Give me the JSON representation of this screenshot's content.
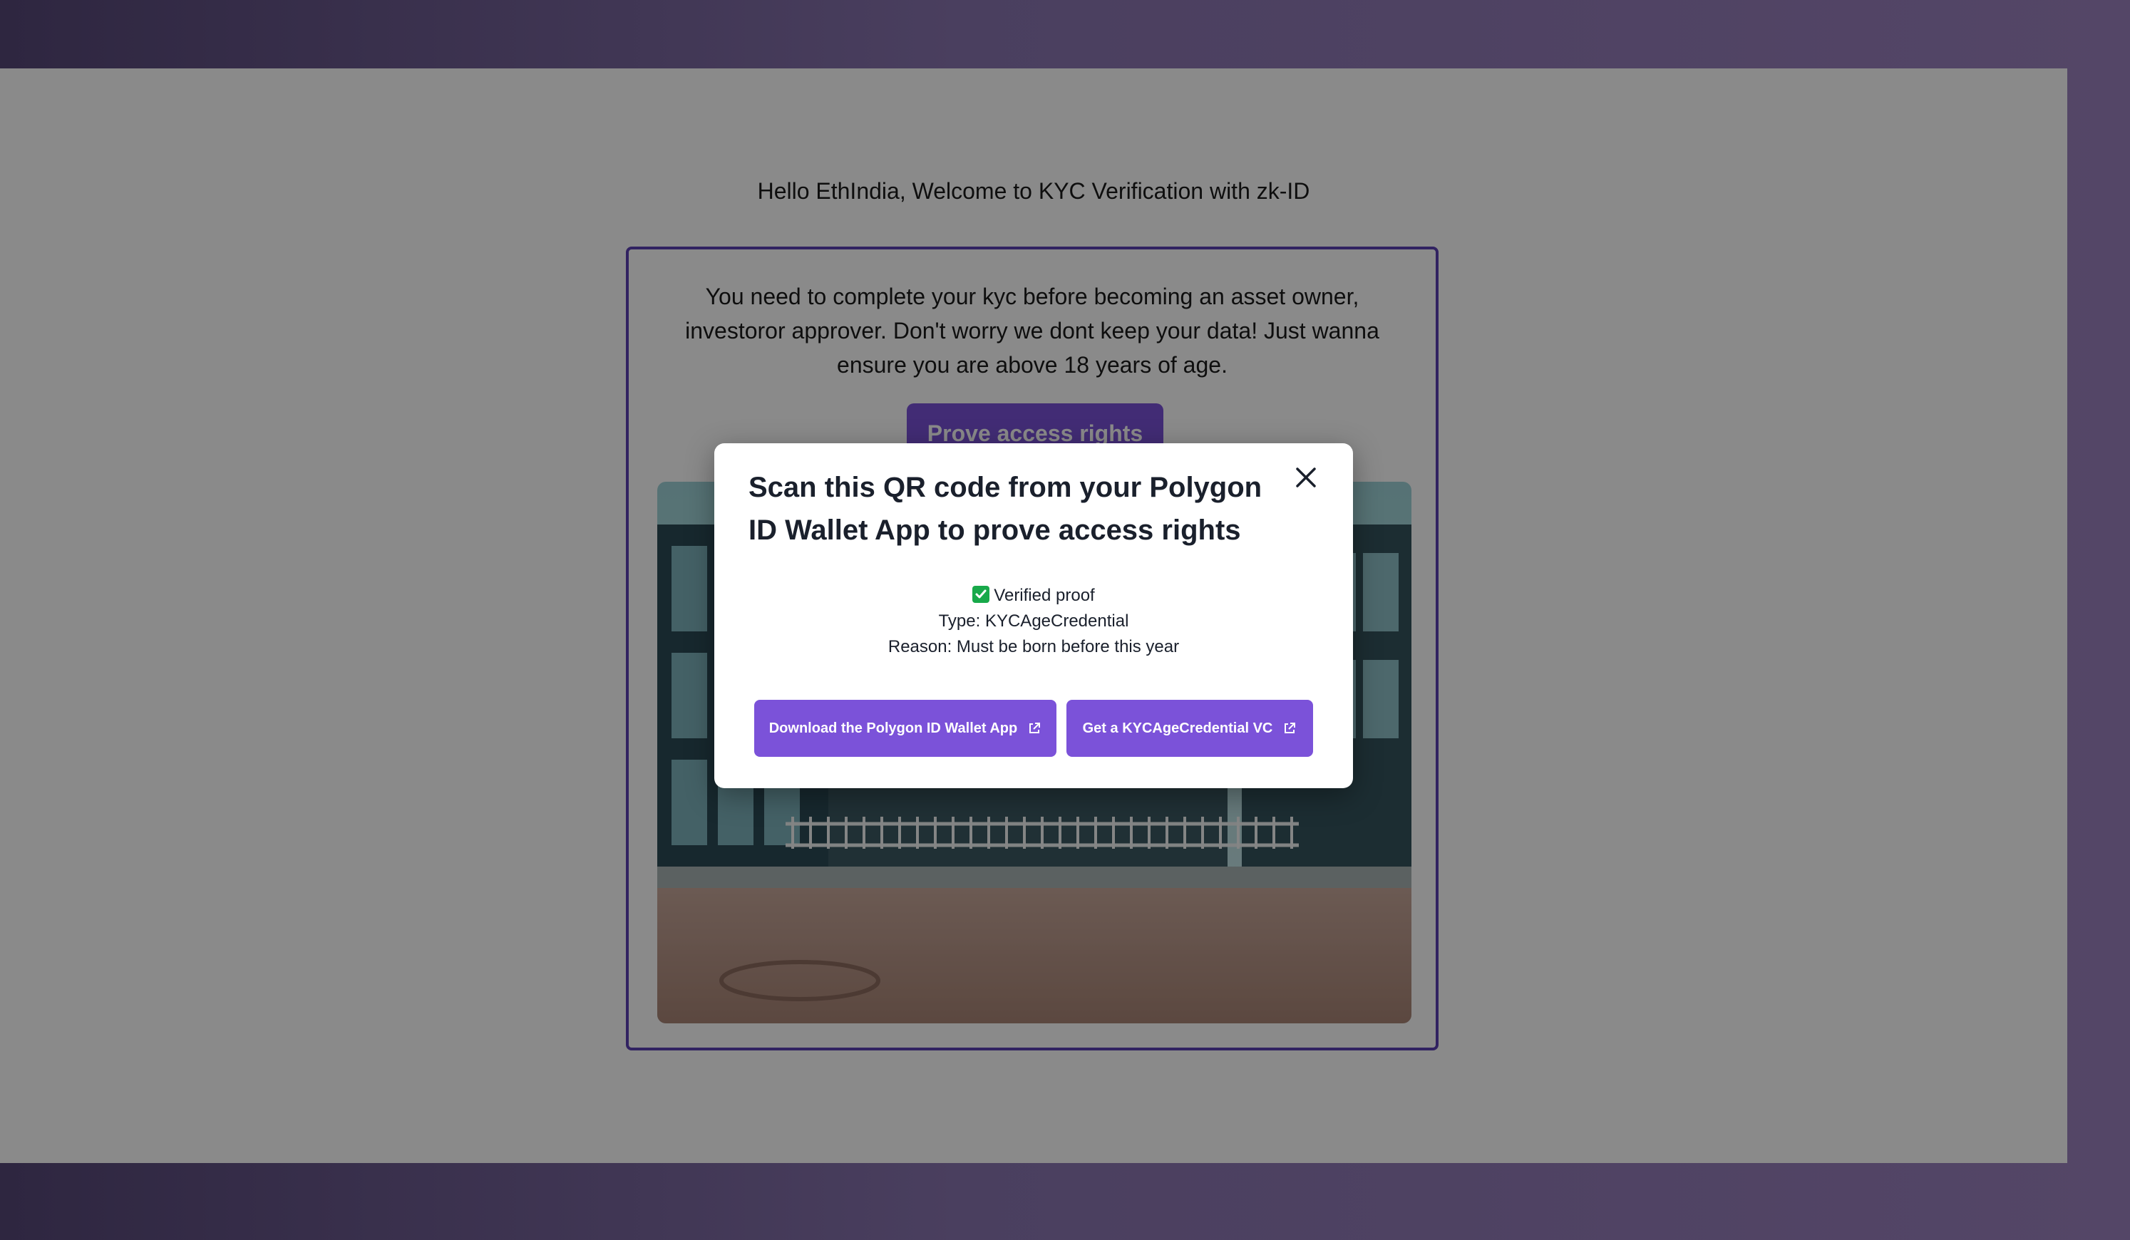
{
  "page": {
    "greeting": "Hello EthIndia, Welcome to KYC Verification with zk-ID"
  },
  "card": {
    "description": "You need to complete your kyc before becoming an asset owner, investoror approver. Don't worry we dont keep your data! Just wanna ensure you are above 18 years of age.",
    "prove_button_label": "Prove access rights",
    "image_icon": "building-photo"
  },
  "modal": {
    "title": "Scan this QR code from your Polygon ID Wallet App to prove access rights",
    "close_icon": "close-icon",
    "status": "Verified proof",
    "type_line": "Type: KYCAgeCredential",
    "reason_line": "Reason: Must be born before this year",
    "download_button_label": "Download the Polygon ID Wallet App",
    "get_vc_button_label": "Get a KYCAgeCredential VC",
    "external_link_icon": "external-link-icon"
  },
  "colors": {
    "accent": "#7b52d9",
    "card_border": "#5b3fb3",
    "verified_green": "#18a94a"
  }
}
